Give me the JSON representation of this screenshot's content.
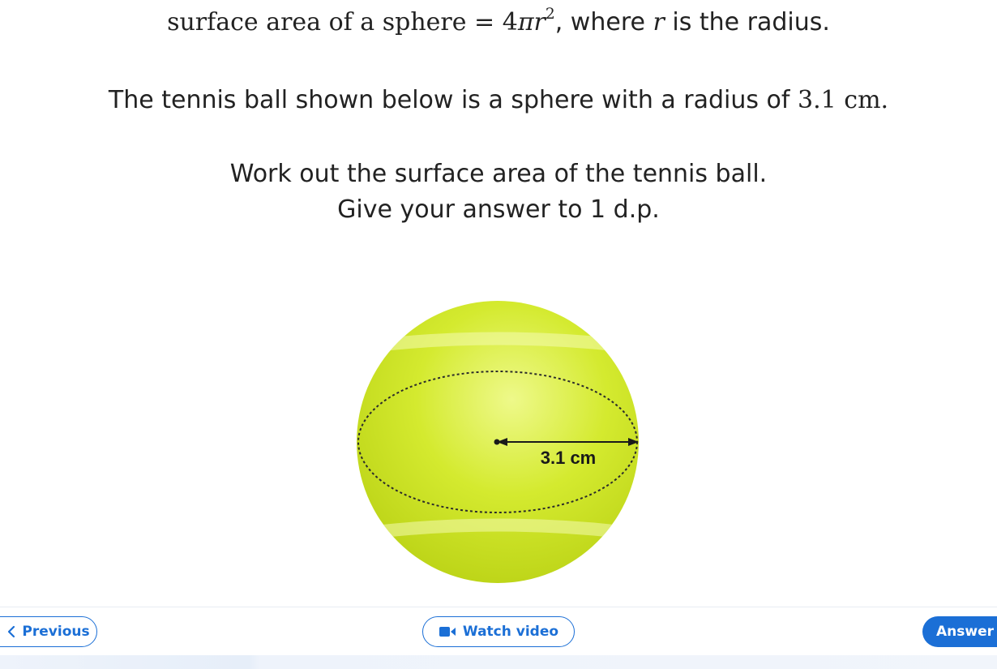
{
  "question": {
    "formula_prefix": "surface area of a sphere",
    "formula_equals": "=",
    "formula_coef": "4",
    "formula_pi": "π",
    "formula_r": "r",
    "formula_exp": "2",
    "formula_where": ", where",
    "formula_var": "r",
    "formula_suffix": "is the radius.",
    "line2_text": "The tennis ball shown below is a sphere with a radius of",
    "line2_value": "3.1",
    "line2_unit": "cm.",
    "line3": "Work out the surface area of the tennis ball.",
    "line4": "Give your answer to 1 d.p."
  },
  "figure": {
    "radius_label": "3.1 cm",
    "colors": {
      "ball_light": "#eef98a",
      "ball_mid": "#d4ea2f",
      "ball_dark": "#b7cf12"
    }
  },
  "footer": {
    "previous_label": "Previous",
    "watch_label": "Watch video",
    "answer_label": "Answer",
    "accent_color": "#1b6fd6"
  }
}
